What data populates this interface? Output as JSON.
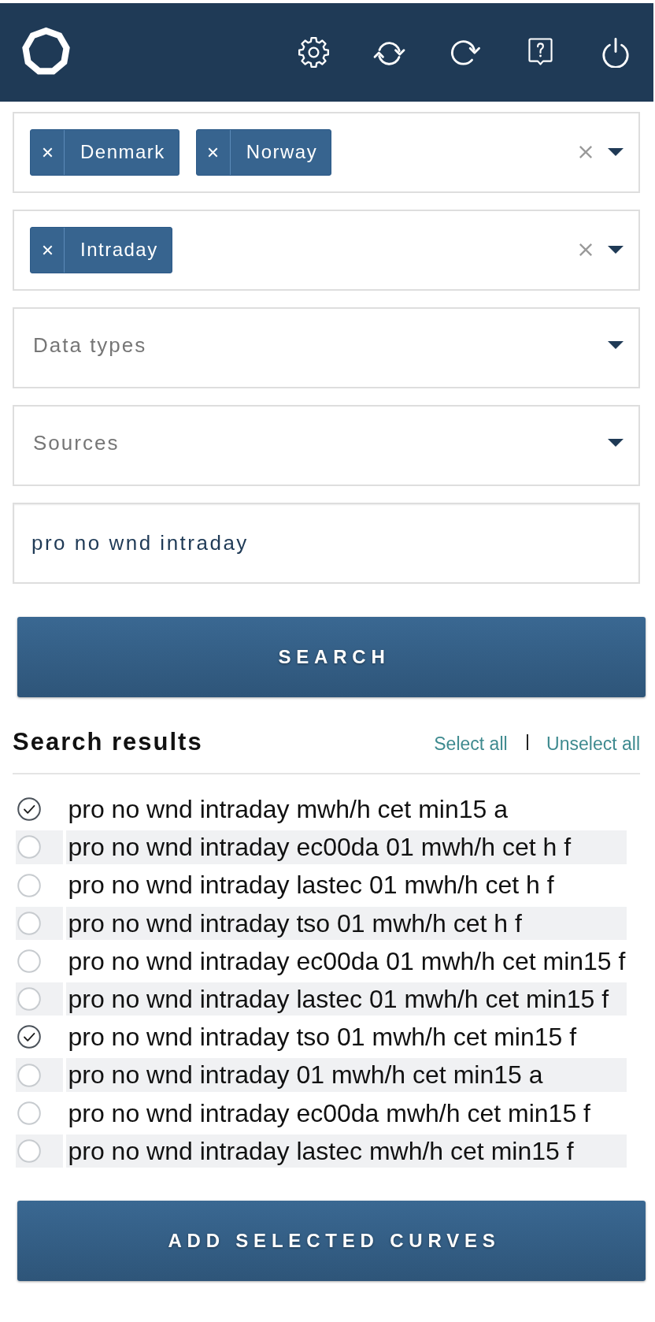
{
  "filters": [
    {
      "kind": "tags",
      "tags": [
        {
          "label": "Denmark"
        },
        {
          "label": "Norway"
        }
      ]
    },
    {
      "kind": "tags",
      "tags": [
        {
          "label": "Intraday"
        }
      ]
    },
    {
      "kind": "dropdown",
      "placeholder": "Data types"
    },
    {
      "kind": "dropdown",
      "placeholder": "Sources"
    },
    {
      "kind": "text",
      "value": "pro no wnd intraday"
    }
  ],
  "search_button": {
    "label": "SEARCH"
  },
  "results": {
    "title": "Search results",
    "select_all": "Select all",
    "unselect_all": "Unselect all",
    "items": [
      {
        "label": "pro no wnd intraday mwh/h cet min15 a",
        "checked": true
      },
      {
        "label": "pro no wnd intraday ec00da 01 mwh/h cet h f",
        "checked": false
      },
      {
        "label": "pro no wnd intraday lastec 01 mwh/h cet h f",
        "checked": false
      },
      {
        "label": "pro no wnd intraday tso 01 mwh/h cet h f",
        "checked": false
      },
      {
        "label": "pro no wnd intraday ec00da 01 mwh/h cet min15 f",
        "checked": false
      },
      {
        "label": "pro no wnd intraday lastec 01 mwh/h cet min15 f",
        "checked": false
      },
      {
        "label": "pro no wnd intraday tso 01 mwh/h cet min15 f",
        "checked": true
      },
      {
        "label": "pro no wnd intraday 01 mwh/h cet min15 a",
        "checked": false
      },
      {
        "label": "pro no wnd intraday ec00da mwh/h cet min15 f",
        "checked": false
      },
      {
        "label": "pro no wnd intraday lastec mwh/h cet min15 f",
        "checked": false
      }
    ]
  },
  "add_button": {
    "label": "ADD SELECTED CURVES"
  }
}
